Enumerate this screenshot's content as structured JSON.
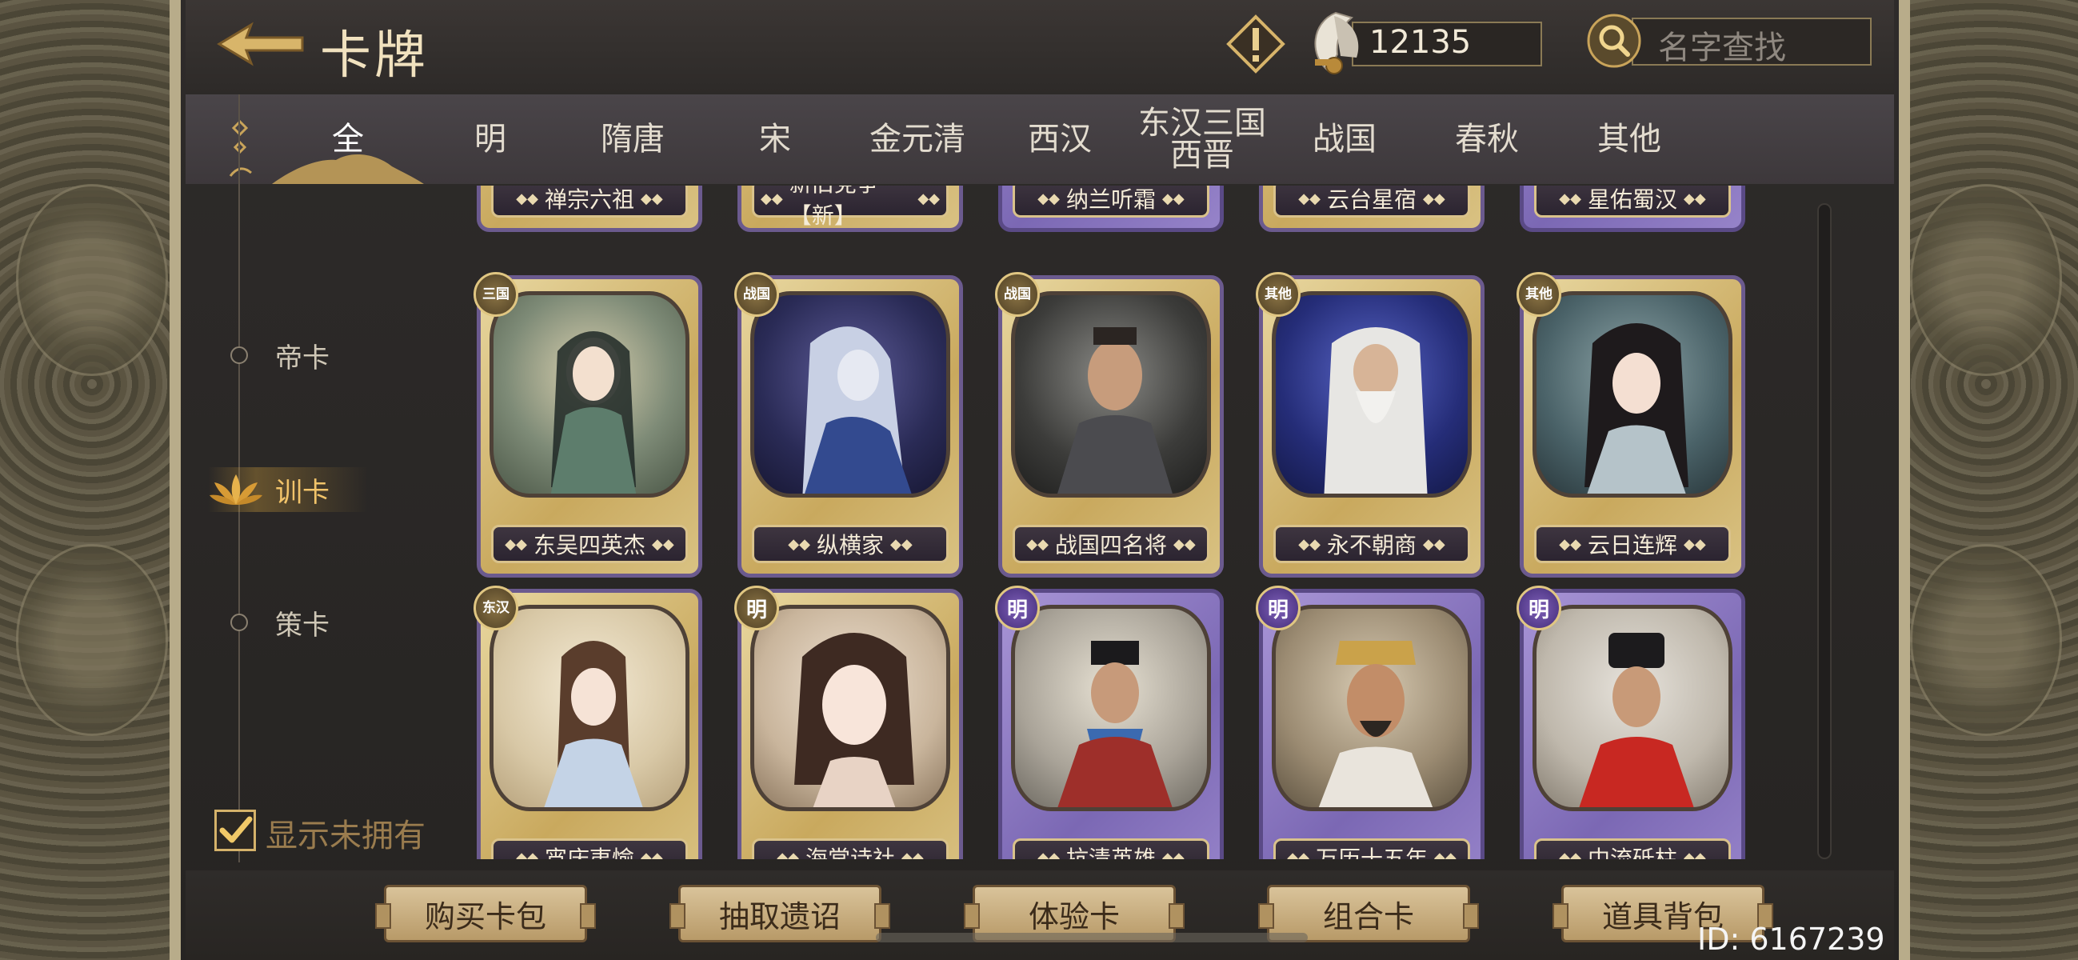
{
  "header": {
    "title": "卡牌",
    "currency_value": "12135",
    "search_placeholder": "名字查找"
  },
  "tabs": [
    {
      "label": "全",
      "active": true
    },
    {
      "label": "明"
    },
    {
      "label": "隋唐"
    },
    {
      "label": "宋"
    },
    {
      "label": "金元清"
    },
    {
      "label": "西汉"
    },
    {
      "label": "东汉三国\n西晋"
    },
    {
      "label": "战国"
    },
    {
      "label": "春秋"
    },
    {
      "label": "其他"
    }
  ],
  "categories": [
    {
      "label": "帝卡"
    },
    {
      "label": "训卡",
      "active": true
    },
    {
      "label": "策卡"
    }
  ],
  "show_unowned_label": "显示未拥有",
  "top_row_names": [
    "禅宗六祖",
    "新旧党争【新】",
    "纳兰听霜",
    "云台星宿",
    "星佑蜀汉"
  ],
  "cards": [
    {
      "name": "东吴四英杰",
      "badge": "三国",
      "style": "gold"
    },
    {
      "name": "纵横家",
      "badge": "战国",
      "style": "gold"
    },
    {
      "name": "战国四名将",
      "badge": "战国",
      "style": "gold"
    },
    {
      "name": "永不朝商",
      "badge": "其他",
      "style": "gold"
    },
    {
      "name": "云日连辉",
      "badge": "其他",
      "style": "gold"
    },
    {
      "name": "宵庆夷愉",
      "badge": "东汉",
      "style": "gold"
    },
    {
      "name": "海棠诗社",
      "badge": "明",
      "style": "gold"
    },
    {
      "name": "抗清英雄",
      "badge": "明",
      "style": "purple"
    },
    {
      "name": "万历十五年",
      "badge": "明",
      "style": "purple"
    },
    {
      "name": "中流砥柱",
      "badge": "明",
      "style": "purple"
    }
  ],
  "bottom_buttons": [
    "购买卡包",
    "抽取遗诏",
    "体验卡",
    "组合卡",
    "道具背包"
  ],
  "player_id": "ID: 6167239",
  "colors": {
    "accent_gold": "#d5b26a",
    "card_purple": "#7b68b4",
    "card_gold": "#c9a95e"
  }
}
